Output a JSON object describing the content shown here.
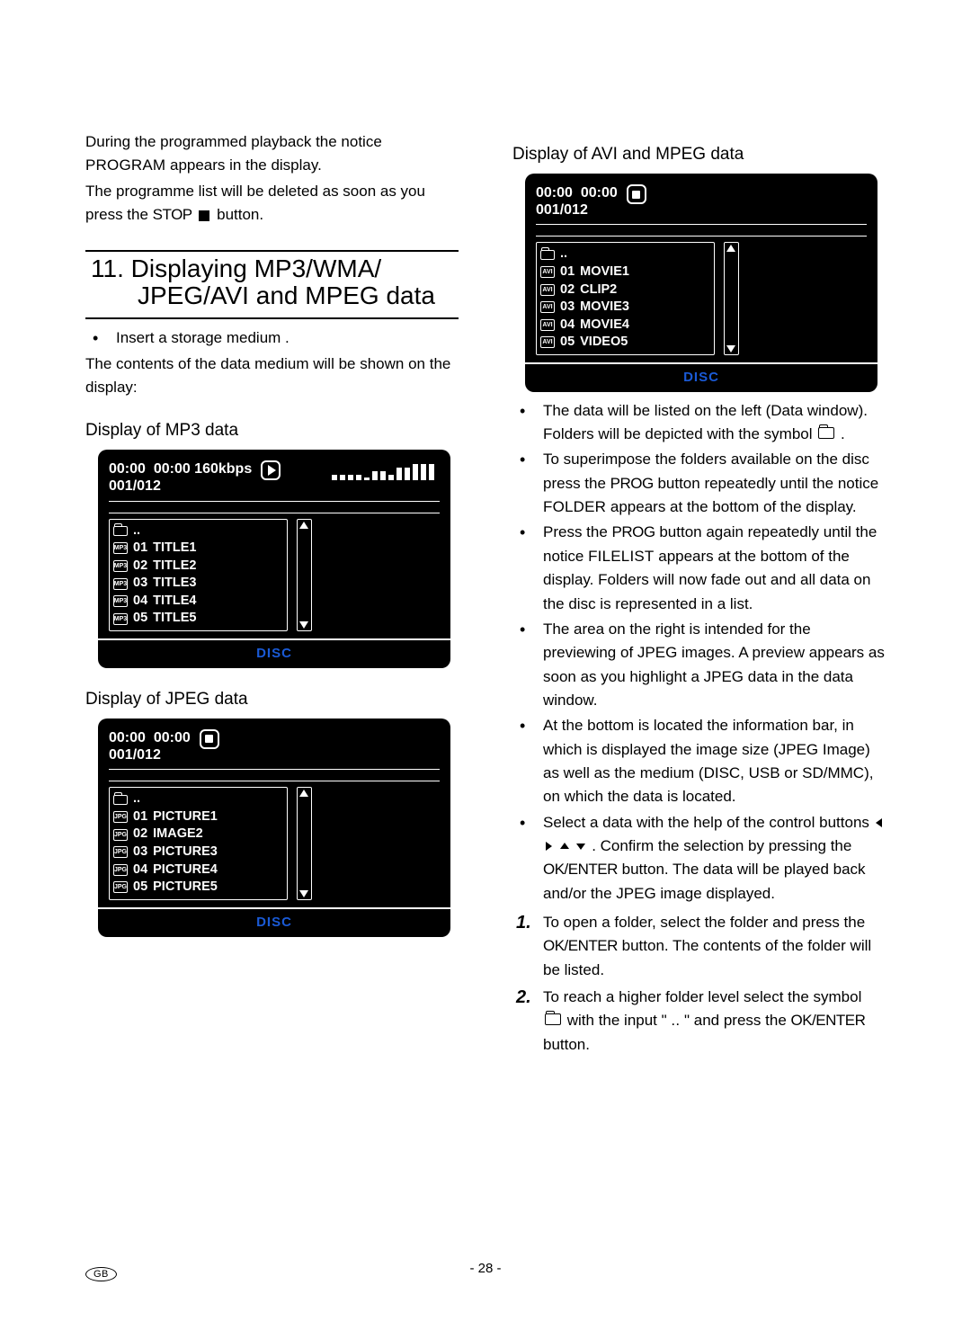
{
  "page_number": "- 28 -",
  "lang_badge": "GB",
  "left": {
    "intro1": "During the programmed playback the notice ",
    "intro_prog": "PROGRAM",
    "intro2": " appears in the display.",
    "intro3_a": "The programme list will be deleted as soon as you press the ",
    "intro3_stop": "STOP",
    "intro3_b": " button.",
    "section_num": "11.",
    "section_l1": "Displaying MP3/WMA/",
    "section_l2": "JPEG/AVI and MPEG data",
    "insert_bullet": "Insert a storage medium .",
    "contents_line": "The contents of the data medium will be shown on the display:",
    "mp3_head": "Display of MP3 data",
    "jpeg_head": "Display of JPEG data"
  },
  "right": {
    "avi_head": "Display of AVI and MPEG data",
    "b1": "The data will be listed on the left (Data window). Folders will be depicted with the symbol ",
    "b1_end": ".",
    "b2_a": "To superimpose the folders available on the disc press the ",
    "b2_prog": "PROG",
    "b2_b": " button repeatedly until the notice ",
    "b2_folder": "FOLDER",
    "b2_c": " appears at the bottom of the display.",
    "b3_a": "Press the ",
    "b3_prog": "PROG",
    "b3_b": " button again repeatedly until the notice ",
    "b3_file": "FILELIST",
    "b3_c": " appears at the bottom of the display. Folders will now fade out and all data on the disc is represented in a list.",
    "b4": "The area on the right is intended for the previewing of JPEG images. A preview appears as soon as you highlight a JPEG data in the data window.",
    "b5": "At the bottom is located the information bar, in which is displayed the image size (JPEG Image) as well as the medium (DISC, USB or SD/MMC), on which the data is located.",
    "b6_a": "Select a data with the help of the control buttons ",
    "b6_b": " . Confirm the selection by pressing the ",
    "b6_ok": "OK/ENTER",
    "b6_c": " button. The data will be played back and/or the JPEG image displayed.",
    "s1_a": "To open a folder, select the folder and press the ",
    "s1_ok": "OK/ENTER",
    "s1_b": " button. The contents of the folder will be listed.",
    "s2_a": "To reach a higher folder level select the symbol ",
    "s2_b": " with the input \"",
    "s2_dots": "..",
    "s2_c": "\" and press the ",
    "s2_ok": "OK/ENTER",
    "s2_d": " button.",
    "step1": "1.",
    "step2": "2."
  },
  "osd": {
    "mp3": {
      "line1": "00:00  00:00 160kbps",
      "line2": "001/012",
      "footer": "DISC",
      "up_label": "..",
      "type": "MP3",
      "eq": [
        6,
        6,
        6,
        6,
        3,
        10,
        10,
        6,
        14,
        14,
        18,
        18,
        18
      ],
      "items": [
        {
          "n": "01",
          "name": "TITLE1"
        },
        {
          "n": "02",
          "name": "TITLE2"
        },
        {
          "n": "03",
          "name": "TITLE3"
        },
        {
          "n": "04",
          "name": "TITLE4"
        },
        {
          "n": "05",
          "name": "TITLE5"
        }
      ]
    },
    "jpeg": {
      "line1": "00:00  00:00",
      "line2": "001/012",
      "footer": "DISC",
      "up_label": "..",
      "type": "JPG",
      "items": [
        {
          "n": "01",
          "name": "PICTURE1"
        },
        {
          "n": "02",
          "name": "IMAGE2"
        },
        {
          "n": "03",
          "name": "PICTURE3"
        },
        {
          "n": "04",
          "name": "PICTURE4"
        },
        {
          "n": "05",
          "name": "PICTURE5"
        }
      ]
    },
    "avi": {
      "line1": "00:00  00:00",
      "line2": "001/012",
      "footer": "DISC",
      "up_label": "..",
      "type": "AVI",
      "items": [
        {
          "n": "01",
          "name": "MOVIE1"
        },
        {
          "n": "02",
          "name": "CLIP2"
        },
        {
          "n": "03",
          "name": "MOVIE3"
        },
        {
          "n": "04",
          "name": "MOVIE4"
        },
        {
          "n": "05",
          "name": "VIDEO5"
        }
      ]
    }
  }
}
